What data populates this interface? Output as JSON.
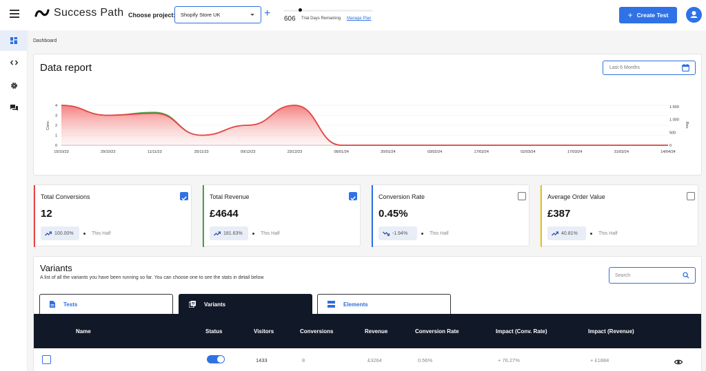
{
  "header": {
    "logo_text": "Success Path",
    "choose_project_label": "Choose project:",
    "project_value": "Shopify Store UK",
    "trial_days": "606",
    "trial_text": "Trial Days Remaining",
    "manage_plan": "Manage Plan",
    "create_test": "Create Test"
  },
  "sidebar": {
    "items": [
      {
        "icon": "dashboard-icon",
        "active": true
      },
      {
        "icon": "code-icon",
        "active": false
      },
      {
        "icon": "gear-icon",
        "active": false
      },
      {
        "icon": "chat-icon",
        "active": false
      }
    ]
  },
  "breadcrumb": "Dashboard",
  "report": {
    "title": "Data report",
    "date_range": "Last 6 Months"
  },
  "chart_data": {
    "type": "area",
    "x": [
      "15/10/23",
      "29/10/23",
      "11/11/23",
      "25/11/23",
      "09/12/23",
      "23/12/23",
      "06/01/24",
      "20/01/24",
      "03/02/24",
      "17/02/24",
      "02/03/24",
      "17/03/24",
      "31/03/24",
      "14/04/24"
    ],
    "series": [
      {
        "name": "",
        "color": "#e84545",
        "values": [
          4,
          3,
          3.2,
          1,
          2,
          4,
          0,
          0,
          0,
          0,
          0,
          0,
          0,
          0
        ]
      },
      {
        "name": "",
        "color": "#3aa64a",
        "values": [
          4,
          3,
          3.3,
          1,
          2,
          4,
          0,
          0,
          0,
          0,
          0,
          0,
          0,
          0
        ]
      }
    ],
    "ylabel_left": "Conv.",
    "ylabel_right": "Rev.",
    "yticks_left": [
      "4",
      "3",
      "2",
      "1",
      "0"
    ],
    "yticks_right": [
      "1.500",
      "1.000",
      "500",
      "0"
    ],
    "ylim": [
      0,
      4
    ],
    "grid": true
  },
  "metrics": [
    {
      "label": "Total Conversions",
      "value": "12",
      "pct": "100.00%",
      "trend": "up",
      "period": "This Half",
      "checked": true,
      "color": "#e84545"
    },
    {
      "label": "Total Revenue",
      "value": "£4644",
      "pct": "181.63%",
      "trend": "up",
      "period": "This Half",
      "checked": true,
      "color": "#3aa64a"
    },
    {
      "label": "Conversion Rate",
      "value": "0.45%",
      "pct": "-1.94%",
      "trend": "down",
      "period": "This Half",
      "checked": false,
      "color": "#2f72e6"
    },
    {
      "label": "Average Order Value",
      "value": "£387",
      "pct": "40.81%",
      "trend": "up",
      "period": "This Half",
      "checked": false,
      "color": "#f2c200"
    }
  ],
  "variants": {
    "title": "Variants",
    "subtitle": "A list of all the variants you have been running so far. You can choose one to see the stats in detail below",
    "search_placeholder": "Search",
    "tabs": [
      {
        "label": "Tests",
        "icon": "document-icon",
        "active": false
      },
      {
        "label": "Variants",
        "icon": "layers-icon",
        "active": true
      },
      {
        "label": "Elements",
        "icon": "rows-icon",
        "active": false
      }
    ],
    "columns": [
      "Name",
      "Status",
      "Visitors",
      "Conversions",
      "Revenue",
      "Conversion Rate",
      "Impact (Conv. Rate)",
      "Impact (Revenue)"
    ],
    "rows": [
      {
        "name": "",
        "status": "on",
        "visitors": "1433",
        "conversions": "8",
        "revenue": "£3264",
        "conversion_rate": "0.56%",
        "impact_conv": "+ 76.27%",
        "impact_rev": "+ £1884"
      }
    ]
  }
}
